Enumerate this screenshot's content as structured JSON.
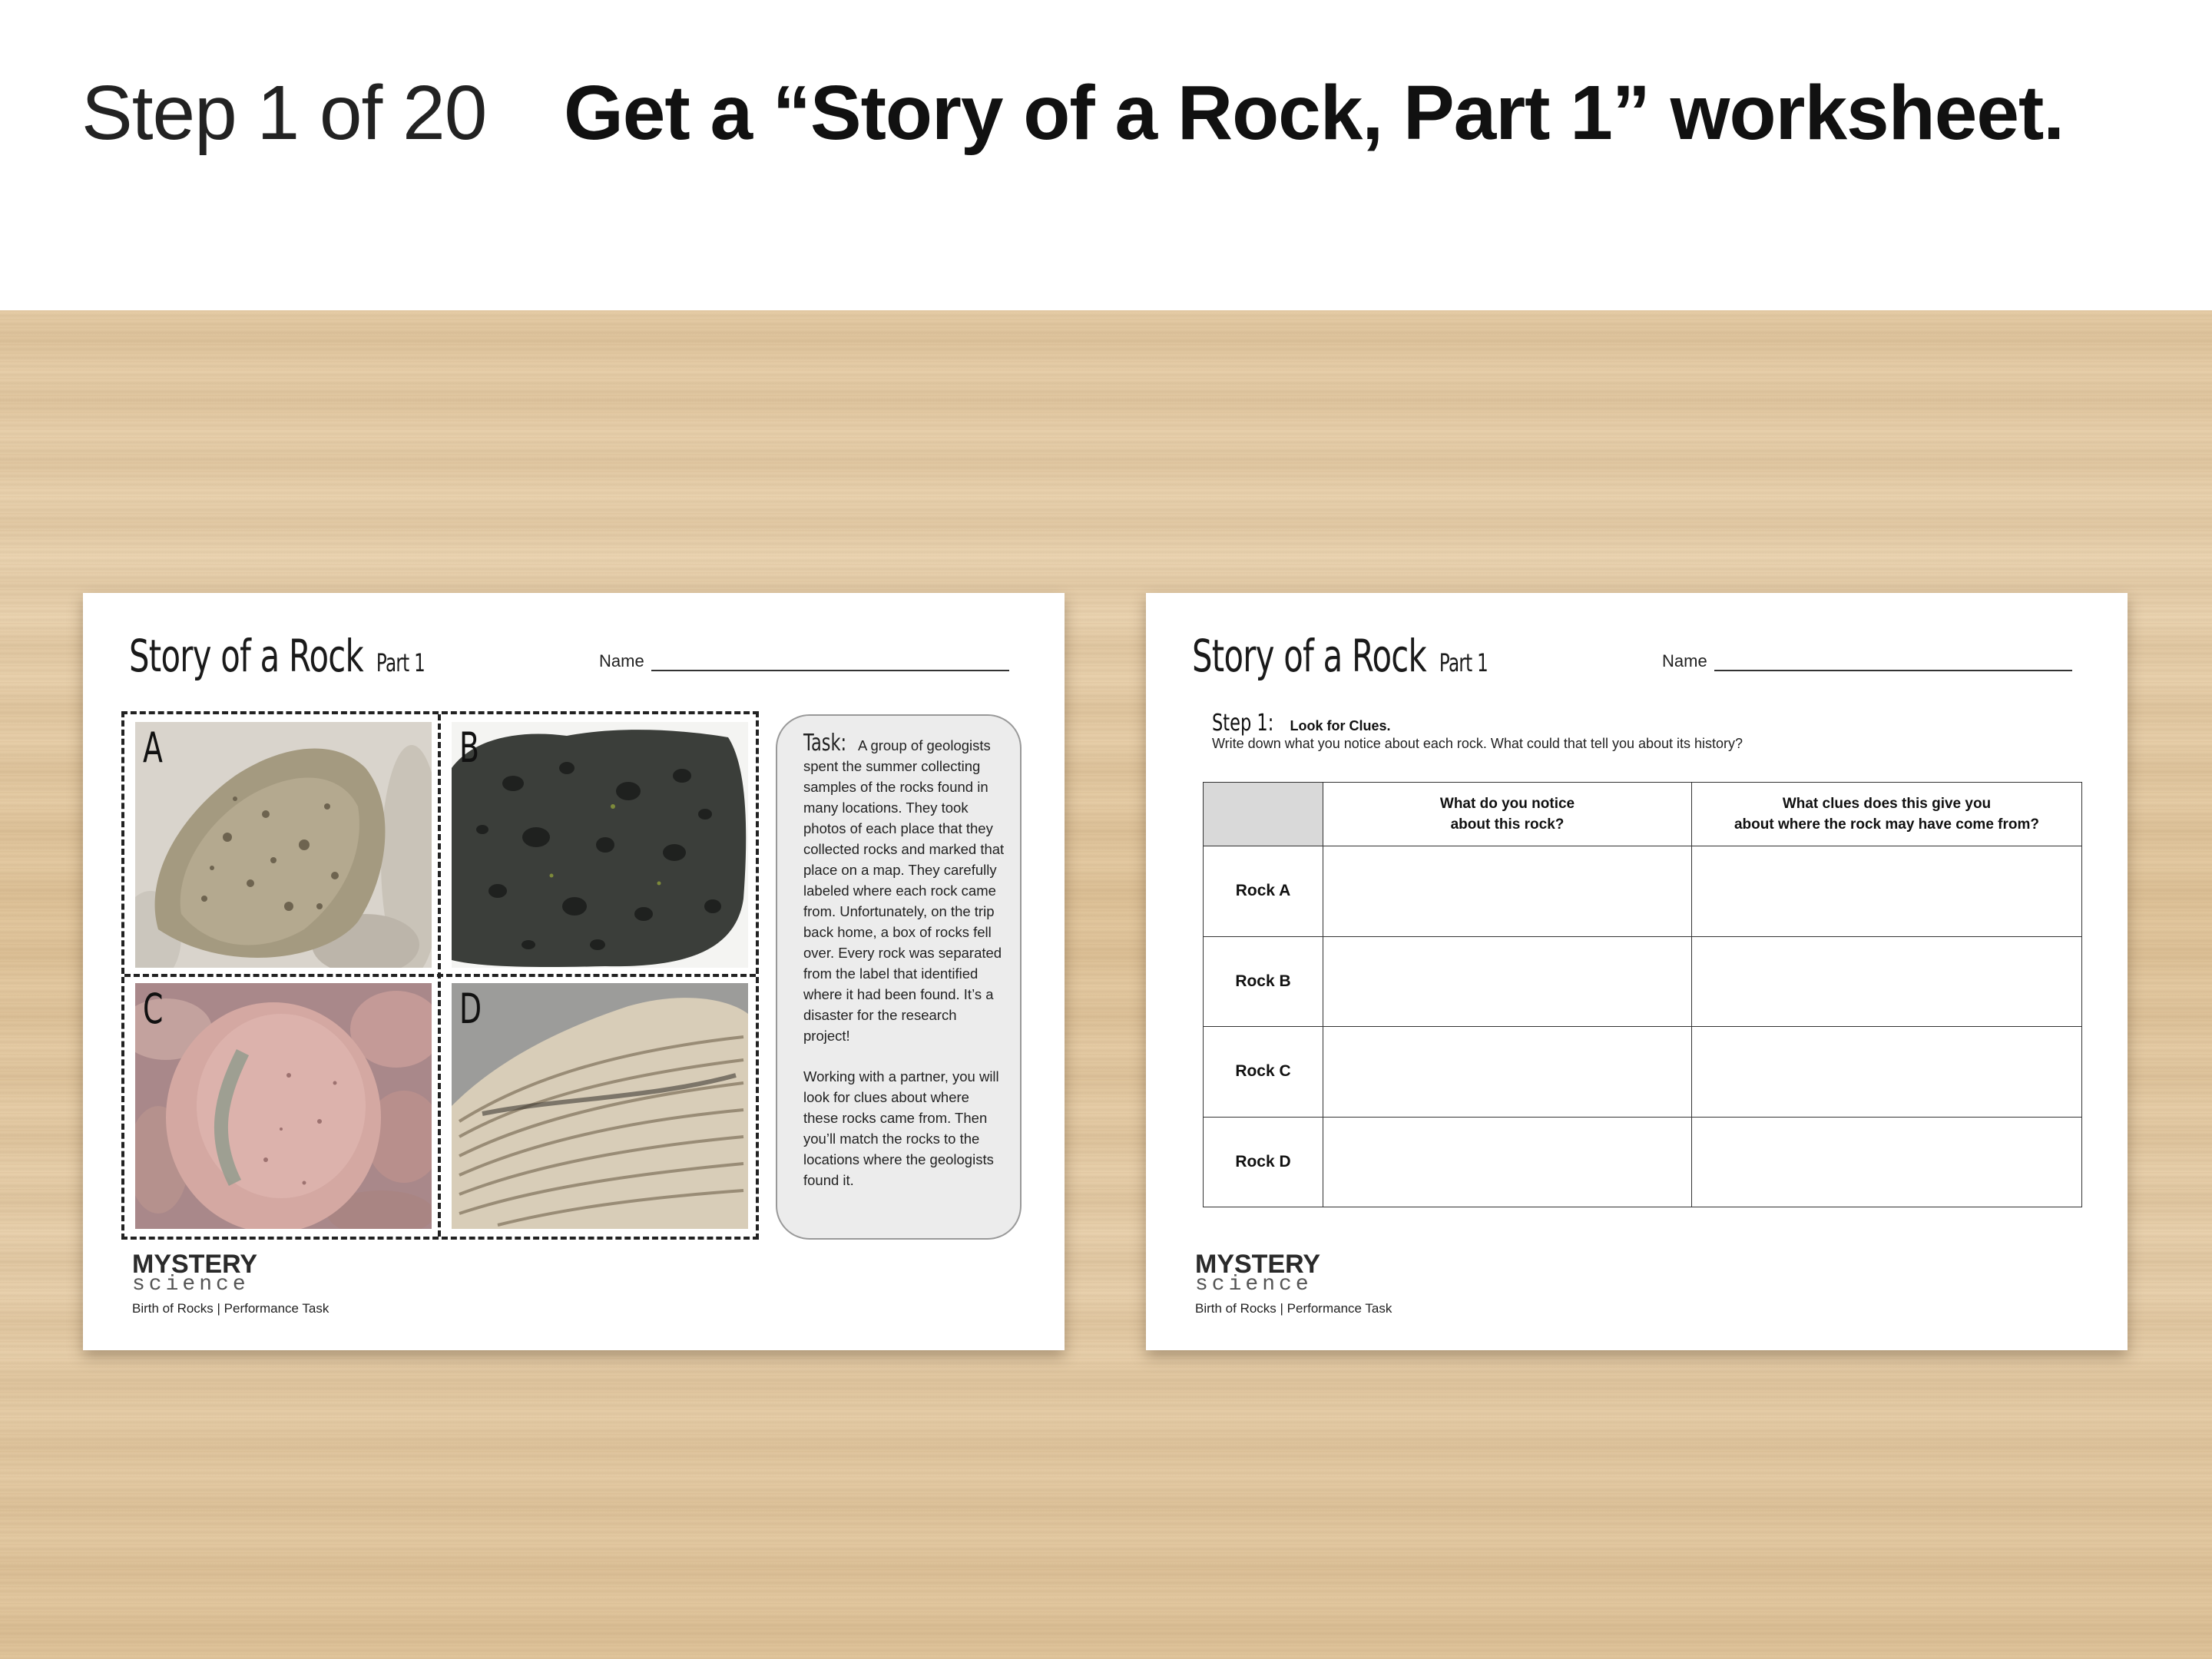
{
  "header": {
    "step_label": "Step 1 of 20",
    "step_title": "Get a “Story of a Rock, Part 1” worksheet."
  },
  "worksheet_left": {
    "title": "Story of a Rock",
    "title_part": "Part 1",
    "name_label": "Name",
    "rocks": [
      {
        "letter": "A"
      },
      {
        "letter": "B"
      },
      {
        "letter": "C"
      },
      {
        "letter": "D"
      }
    ],
    "task_heading": "Task:",
    "task_paragraph_1": "A group of geologists spent the summer collecting samples of the rocks found in many locations. They took photos of each place that they collected rocks and marked that place on a map. They carefully labeled where each rock came from. Unfortunately, on the trip back home, a box of rocks fell over. Every rock was separated from the label that identified where it had been found. It’s a disaster for the research project!",
    "task_paragraph_2": "Working with a partner, you will look for clues about where these rocks came from. Then you’ll match the rocks to the locations where the geologists found it.",
    "logo_top": "MYSTERY",
    "logo_bottom": "science",
    "footer": "Birth of Rocks | Performance Task"
  },
  "worksheet_right": {
    "title": "Story of a Rock",
    "title_part": "Part 1",
    "name_label": "Name",
    "step_heading": "Step 1:",
    "step_subheading": "Look for Clues.",
    "instruction": "Write down what you notice about each rock. What could that tell you about its history?",
    "table": {
      "col1_line1": "What do you notice",
      "col1_line2": "about this rock?",
      "col2_line1": "What clues does this give you",
      "col2_line2": "about where the rock may have come from?",
      "rows": [
        "Rock A",
        "Rock B",
        "Rock C",
        "Rock D"
      ]
    },
    "logo_top": "MYSTERY",
    "logo_bottom": "science",
    "footer": "Birth of Rocks | Performance Task"
  }
}
